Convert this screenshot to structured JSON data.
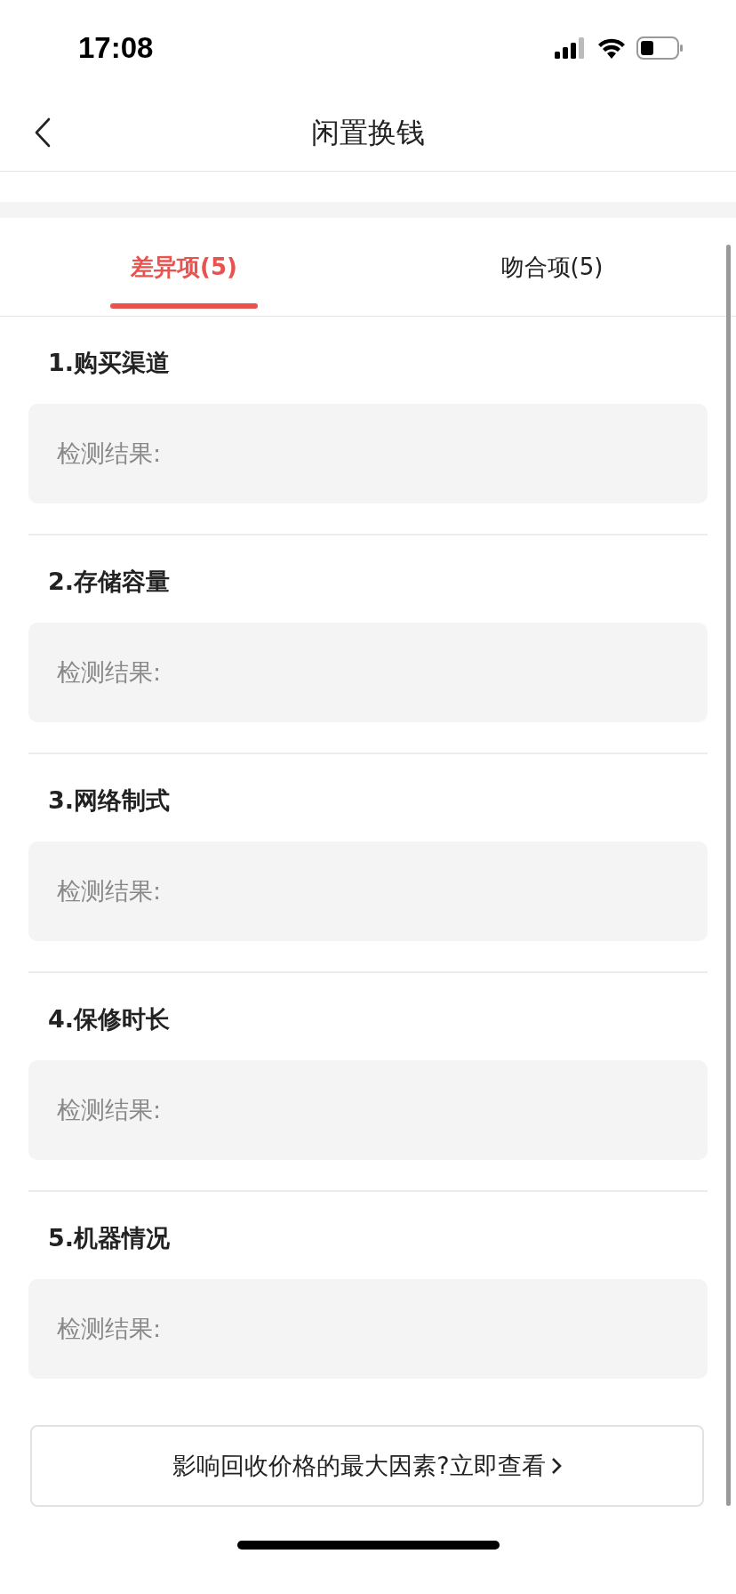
{
  "status_bar": {
    "time": "17:08"
  },
  "nav": {
    "title": "闲置换钱"
  },
  "tabs": [
    {
      "label": "差异项(5)",
      "selected": true
    },
    {
      "label": "吻合项(5)",
      "selected": false
    }
  ],
  "sections": [
    {
      "title": "1.购买渠道",
      "result": "检测结果:"
    },
    {
      "title": "2.存储容量",
      "result": "检测结果:"
    },
    {
      "title": "3.网络制式",
      "result": "检测结果:"
    },
    {
      "title": "4.保修时长",
      "result": "检测结果:"
    },
    {
      "title": "5.机器情况",
      "result": "检测结果:"
    }
  ],
  "footer_button": {
    "label": "影响回收价格的最大因素?立即查看"
  }
}
